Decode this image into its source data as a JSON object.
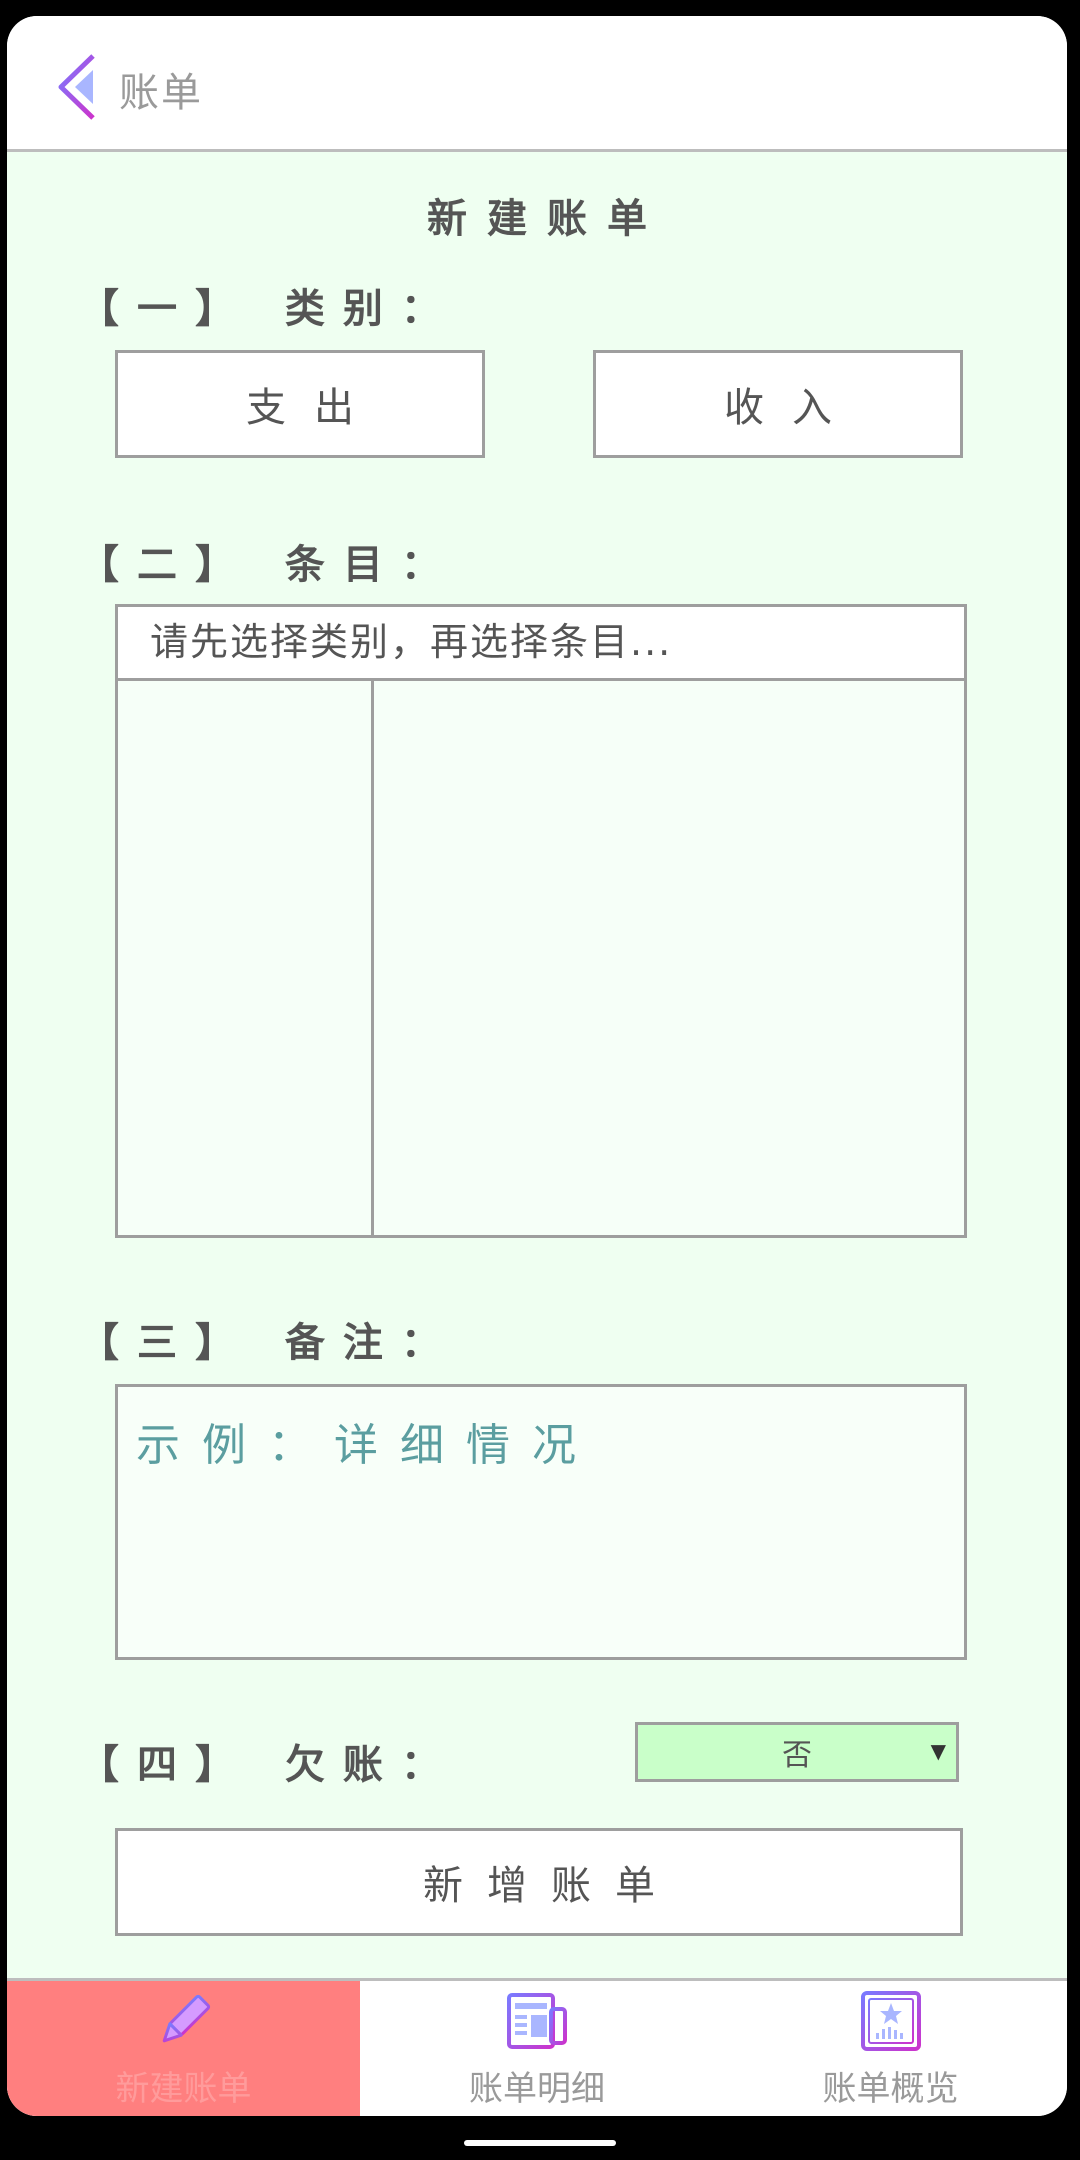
{
  "header": {
    "title": "账单"
  },
  "form": {
    "title": "新建账单",
    "section1": {
      "label": "【一】 类别：",
      "expense": "支出",
      "income": "收入"
    },
    "section2": {
      "label": "【二】 条目：",
      "hint": "请先选择类别，再选择条目..."
    },
    "section3": {
      "label": "【三】 备注：",
      "placeholder": "示例：详细情况"
    },
    "section4": {
      "label": "【四】 欠账：",
      "selected": "否"
    },
    "submit": "新增账单"
  },
  "nav": {
    "items": [
      {
        "label": "新建账单",
        "icon": "pencil-icon",
        "active": true
      },
      {
        "label": "账单明细",
        "icon": "bill-detail-icon",
        "active": false
      },
      {
        "label": "账单概览",
        "icon": "overview-chart-icon",
        "active": false
      }
    ]
  },
  "colors": {
    "form_bg": "#effff1",
    "active_nav": "#ff7f7f",
    "select_bg": "#c9ffc9",
    "placeholder": "#5b9ea0"
  }
}
